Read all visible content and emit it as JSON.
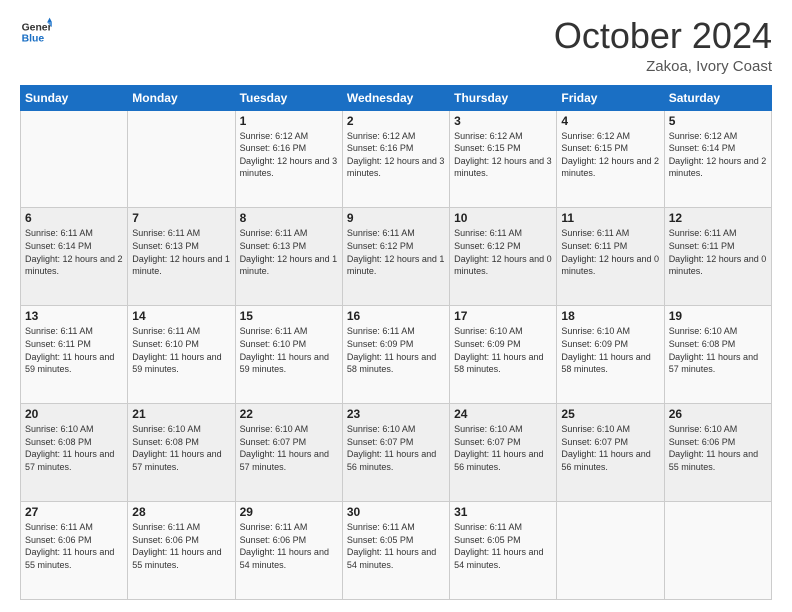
{
  "logo": {
    "line1": "General",
    "line2": "Blue"
  },
  "header": {
    "month": "October 2024",
    "location": "Zakoa, Ivory Coast"
  },
  "weekdays": [
    "Sunday",
    "Monday",
    "Tuesday",
    "Wednesday",
    "Thursday",
    "Friday",
    "Saturday"
  ],
  "weeks": [
    [
      {
        "day": "",
        "sunrise": "",
        "sunset": "",
        "daylight": ""
      },
      {
        "day": "",
        "sunrise": "",
        "sunset": "",
        "daylight": ""
      },
      {
        "day": "1",
        "sunrise": "Sunrise: 6:12 AM",
        "sunset": "Sunset: 6:16 PM",
        "daylight": "Daylight: 12 hours and 3 minutes."
      },
      {
        "day": "2",
        "sunrise": "Sunrise: 6:12 AM",
        "sunset": "Sunset: 6:16 PM",
        "daylight": "Daylight: 12 hours and 3 minutes."
      },
      {
        "day": "3",
        "sunrise": "Sunrise: 6:12 AM",
        "sunset": "Sunset: 6:15 PM",
        "daylight": "Daylight: 12 hours and 3 minutes."
      },
      {
        "day": "4",
        "sunrise": "Sunrise: 6:12 AM",
        "sunset": "Sunset: 6:15 PM",
        "daylight": "Daylight: 12 hours and 2 minutes."
      },
      {
        "day": "5",
        "sunrise": "Sunrise: 6:12 AM",
        "sunset": "Sunset: 6:14 PM",
        "daylight": "Daylight: 12 hours and 2 minutes."
      }
    ],
    [
      {
        "day": "6",
        "sunrise": "Sunrise: 6:11 AM",
        "sunset": "Sunset: 6:14 PM",
        "daylight": "Daylight: 12 hours and 2 minutes."
      },
      {
        "day": "7",
        "sunrise": "Sunrise: 6:11 AM",
        "sunset": "Sunset: 6:13 PM",
        "daylight": "Daylight: 12 hours and 1 minute."
      },
      {
        "day": "8",
        "sunrise": "Sunrise: 6:11 AM",
        "sunset": "Sunset: 6:13 PM",
        "daylight": "Daylight: 12 hours and 1 minute."
      },
      {
        "day": "9",
        "sunrise": "Sunrise: 6:11 AM",
        "sunset": "Sunset: 6:12 PM",
        "daylight": "Daylight: 12 hours and 1 minute."
      },
      {
        "day": "10",
        "sunrise": "Sunrise: 6:11 AM",
        "sunset": "Sunset: 6:12 PM",
        "daylight": "Daylight: 12 hours and 0 minutes."
      },
      {
        "day": "11",
        "sunrise": "Sunrise: 6:11 AM",
        "sunset": "Sunset: 6:11 PM",
        "daylight": "Daylight: 12 hours and 0 minutes."
      },
      {
        "day": "12",
        "sunrise": "Sunrise: 6:11 AM",
        "sunset": "Sunset: 6:11 PM",
        "daylight": "Daylight: 12 hours and 0 minutes."
      }
    ],
    [
      {
        "day": "13",
        "sunrise": "Sunrise: 6:11 AM",
        "sunset": "Sunset: 6:11 PM",
        "daylight": "Daylight: 11 hours and 59 minutes."
      },
      {
        "day": "14",
        "sunrise": "Sunrise: 6:11 AM",
        "sunset": "Sunset: 6:10 PM",
        "daylight": "Daylight: 11 hours and 59 minutes."
      },
      {
        "day": "15",
        "sunrise": "Sunrise: 6:11 AM",
        "sunset": "Sunset: 6:10 PM",
        "daylight": "Daylight: 11 hours and 59 minutes."
      },
      {
        "day": "16",
        "sunrise": "Sunrise: 6:11 AM",
        "sunset": "Sunset: 6:09 PM",
        "daylight": "Daylight: 11 hours and 58 minutes."
      },
      {
        "day": "17",
        "sunrise": "Sunrise: 6:10 AM",
        "sunset": "Sunset: 6:09 PM",
        "daylight": "Daylight: 11 hours and 58 minutes."
      },
      {
        "day": "18",
        "sunrise": "Sunrise: 6:10 AM",
        "sunset": "Sunset: 6:09 PM",
        "daylight": "Daylight: 11 hours and 58 minutes."
      },
      {
        "day": "19",
        "sunrise": "Sunrise: 6:10 AM",
        "sunset": "Sunset: 6:08 PM",
        "daylight": "Daylight: 11 hours and 57 minutes."
      }
    ],
    [
      {
        "day": "20",
        "sunrise": "Sunrise: 6:10 AM",
        "sunset": "Sunset: 6:08 PM",
        "daylight": "Daylight: 11 hours and 57 minutes."
      },
      {
        "day": "21",
        "sunrise": "Sunrise: 6:10 AM",
        "sunset": "Sunset: 6:08 PM",
        "daylight": "Daylight: 11 hours and 57 minutes."
      },
      {
        "day": "22",
        "sunrise": "Sunrise: 6:10 AM",
        "sunset": "Sunset: 6:07 PM",
        "daylight": "Daylight: 11 hours and 57 minutes."
      },
      {
        "day": "23",
        "sunrise": "Sunrise: 6:10 AM",
        "sunset": "Sunset: 6:07 PM",
        "daylight": "Daylight: 11 hours and 56 minutes."
      },
      {
        "day": "24",
        "sunrise": "Sunrise: 6:10 AM",
        "sunset": "Sunset: 6:07 PM",
        "daylight": "Daylight: 11 hours and 56 minutes."
      },
      {
        "day": "25",
        "sunrise": "Sunrise: 6:10 AM",
        "sunset": "Sunset: 6:07 PM",
        "daylight": "Daylight: 11 hours and 56 minutes."
      },
      {
        "day": "26",
        "sunrise": "Sunrise: 6:10 AM",
        "sunset": "Sunset: 6:06 PM",
        "daylight": "Daylight: 11 hours and 55 minutes."
      }
    ],
    [
      {
        "day": "27",
        "sunrise": "Sunrise: 6:11 AM",
        "sunset": "Sunset: 6:06 PM",
        "daylight": "Daylight: 11 hours and 55 minutes."
      },
      {
        "day": "28",
        "sunrise": "Sunrise: 6:11 AM",
        "sunset": "Sunset: 6:06 PM",
        "daylight": "Daylight: 11 hours and 55 minutes."
      },
      {
        "day": "29",
        "sunrise": "Sunrise: 6:11 AM",
        "sunset": "Sunset: 6:06 PM",
        "daylight": "Daylight: 11 hours and 54 minutes."
      },
      {
        "day": "30",
        "sunrise": "Sunrise: 6:11 AM",
        "sunset": "Sunset: 6:05 PM",
        "daylight": "Daylight: 11 hours and 54 minutes."
      },
      {
        "day": "31",
        "sunrise": "Sunrise: 6:11 AM",
        "sunset": "Sunset: 6:05 PM",
        "daylight": "Daylight: 11 hours and 54 minutes."
      },
      {
        "day": "",
        "sunrise": "",
        "sunset": "",
        "daylight": ""
      },
      {
        "day": "",
        "sunrise": "",
        "sunset": "",
        "daylight": ""
      }
    ]
  ]
}
